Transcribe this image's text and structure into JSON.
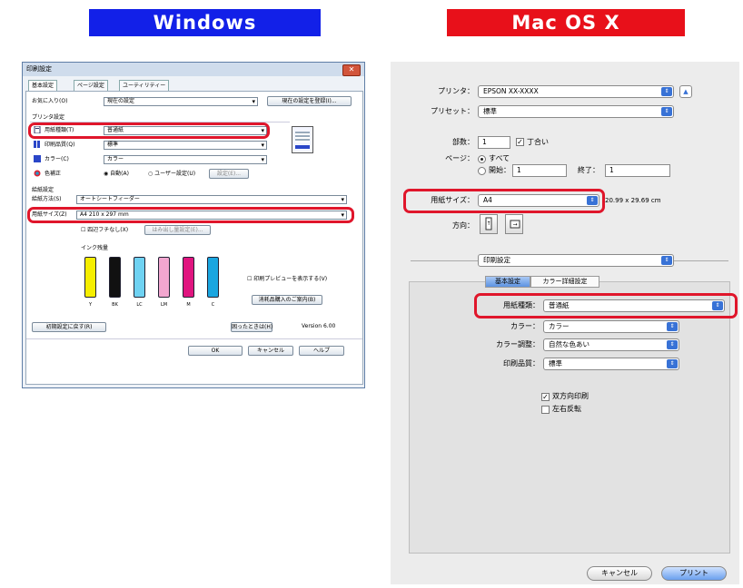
{
  "banners": {
    "windows": "Windows",
    "mac": "Mac OS X"
  },
  "win": {
    "title": "印刷設定",
    "tabs": [
      "基本設定",
      "ページ設定",
      "ユーティリティー"
    ],
    "favorites_label": "お気に入り(O)",
    "favorites_value": "現在の設定",
    "save_favorites": "現在の設定を登録(I)...",
    "media_section": "プリンタ設定",
    "paper_type_label": "用紙種類(T)",
    "paper_type_value": "普通紙",
    "quality_label": "印刷品質(Q)",
    "quality_value": "標準",
    "color_label": "カラー(C)",
    "color_value": "カラー",
    "color_correction_label": "色補正",
    "auto_radio": "自動(A)",
    "user_radio": "ユーザー設定(U)",
    "settings_button": "設定(E)...",
    "paper_section": "給紙設定",
    "source_label": "給紙方法(S)",
    "source_value": "オートシートフィーダー",
    "size_label": "用紙サイズ(Z)",
    "size_value": "A4 210 x 297 mm",
    "borderless_label": "四辺フチなし(X)",
    "extension_button": "はみ出し量設定(E)...",
    "ink_label": "インク残量",
    "ink_colors": [
      "Y",
      "BK",
      "LC",
      "LM",
      "M",
      "C"
    ],
    "ink_hex": [
      "#f6ee00",
      "#111111",
      "#6fd2f2",
      "#f2a6cf",
      "#e0157f",
      "#1aa6e0"
    ],
    "preview_check": "印刷プレビューを表示する(V)",
    "buy_ink": "消耗品購入のご案内(B)",
    "reset_button": "初期設定に戻す(R)",
    "assistant_button": "困ったときは(H)",
    "version": "Version 6.00",
    "ok": "OK",
    "cancel": "キャンセル",
    "help": "ヘルプ"
  },
  "mac": {
    "printer_label": "プリンタ：",
    "printer_value": "EPSON XX-XXXX",
    "preset_label": "プリセット：",
    "preset_value": "標準",
    "copies_label": "部数：",
    "copies_value": "1",
    "collate_label": "丁合い",
    "pages_label": "ページ：",
    "all_label": "すべて",
    "from_label": "開始：",
    "from_value": "1",
    "to_label": "終了：",
    "to_value": "1",
    "paper_size_label": "用紙サイズ：",
    "paper_size_value": "A4",
    "paper_size_dims": "20.99 x 29.69 cm",
    "orientation_label": "方向：",
    "panel_popup": "印刷設定",
    "tab_basic": "基本設定",
    "tab_color": "カラー詳細設定",
    "media_label": "用紙種類：",
    "media_value": "普通紙",
    "color_label": "カラー：",
    "color_value": "カラー",
    "color_adj_label": "カラー調整：",
    "color_adj_value": "自然な色あい",
    "quality_label": "印刷品質：",
    "quality_value": "標準",
    "bidi_label": "双方向印刷",
    "mirror_label": "左右反転",
    "cancel": "キャンセル",
    "print": "プリント"
  },
  "colors": {
    "windows_banner": "#1220e8",
    "mac_banner": "#e8101a",
    "highlight": "#e0162b",
    "mac_accent": "#3872d6"
  }
}
